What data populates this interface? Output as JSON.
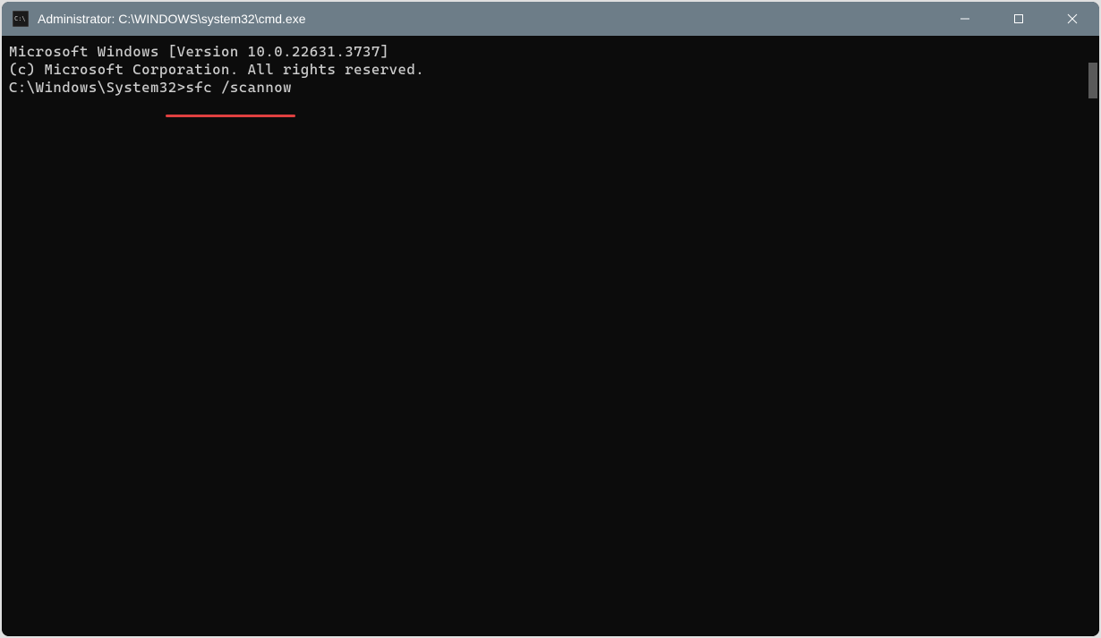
{
  "titlebar": {
    "title": "Administrator: C:\\WINDOWS\\system32\\cmd.exe",
    "icon_name": "cmd-icon"
  },
  "window_controls": {
    "minimize": "minimize",
    "maximize": "maximize",
    "close": "close"
  },
  "terminal": {
    "line1": "Microsoft Windows [Version 10.0.22631.3737]",
    "line2": "(c) Microsoft Corporation. All rights reserved.",
    "blank": "",
    "prompt": "C:\\Windows\\System32>",
    "command": "sfc /scannow"
  },
  "annotation": {
    "underline_target": "sfc /scannow",
    "color": "#e04040"
  }
}
